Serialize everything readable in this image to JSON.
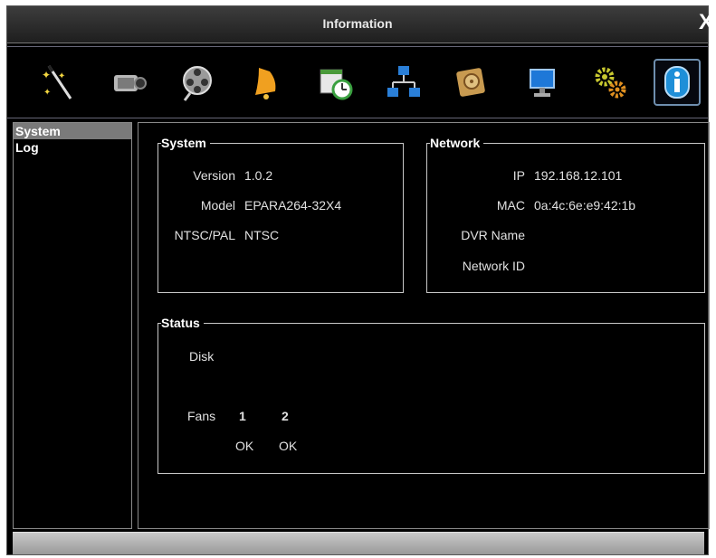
{
  "window": {
    "title": "Information",
    "close_glyph": "X"
  },
  "toolbar": {
    "icons": [
      {
        "name": "wizard-icon"
      },
      {
        "name": "camera-icon"
      },
      {
        "name": "film-reel-icon"
      },
      {
        "name": "alarm-bell-icon"
      },
      {
        "name": "schedule-calendar-icon"
      },
      {
        "name": "network-icon"
      },
      {
        "name": "storage-disk-icon"
      },
      {
        "name": "display-monitor-icon"
      },
      {
        "name": "settings-gears-icon"
      },
      {
        "name": "info-icon",
        "active": true
      }
    ]
  },
  "sidebar": {
    "items": [
      {
        "label": "System",
        "selected": true
      },
      {
        "label": "Log",
        "selected": false
      }
    ]
  },
  "system": {
    "heading": "System",
    "version_label": "Version",
    "version_value": "1.0.2",
    "model_label": "Model",
    "model_value": "EPARA264-32X4",
    "ntscpal_label": "NTSC/PAL",
    "ntscpal_value": "NTSC"
  },
  "network": {
    "heading": "Network",
    "ip_label": "IP",
    "ip_value": "192.168.12.101",
    "mac_label": "MAC",
    "mac_value": "0a:4c:6e:e9:42:1b",
    "dvr_name_label": "DVR Name",
    "dvr_name_value": "",
    "network_id_label": "Network ID",
    "network_id_value": ""
  },
  "status": {
    "heading": "Status",
    "disk_label": "Disk",
    "fans_label": "Fans",
    "fans": [
      {
        "number": "1",
        "state": "OK"
      },
      {
        "number": "2",
        "state": "OK"
      }
    ]
  },
  "colors": {
    "background": "#000000",
    "border": "#c8c8c8",
    "selection": "#7a7a7a",
    "info_blue": "#1f8fd8"
  }
}
